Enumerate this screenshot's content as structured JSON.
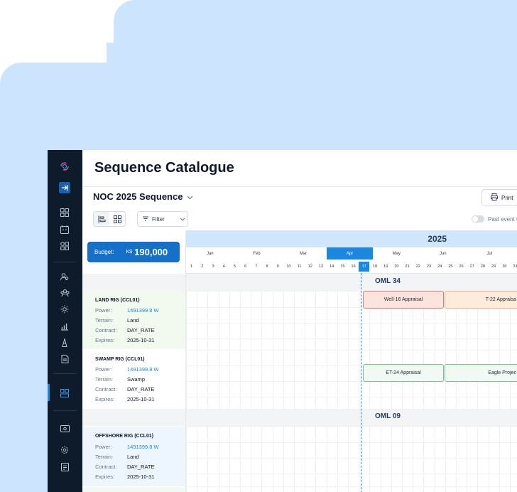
{
  "page": {
    "title": "Sequence Catalogue"
  },
  "header": {
    "sequence_name": "NOC 2025 Sequence",
    "print_label": "Print",
    "filter_label": "Filter",
    "past_events_label": "Past event t"
  },
  "budget": {
    "label": "Budget:",
    "currency": "K$",
    "amount": "190,000"
  },
  "timeline": {
    "year": "2025",
    "months": [
      "Jan",
      "Feb",
      "Mar",
      "Apr",
      "May",
      "Jun",
      "Jul"
    ],
    "active_month": "Apr",
    "days": [
      "1",
      "2",
      "3",
      "4",
      "5",
      "6",
      "7",
      "8",
      "9",
      "10",
      "11",
      "12",
      "13",
      "14",
      "15",
      "16",
      "17",
      "18",
      "19",
      "20",
      "21",
      "22",
      "23",
      "24",
      "25",
      "26",
      "27",
      "28",
      "29",
      "30",
      "31"
    ],
    "today": "17"
  },
  "groups": [
    {
      "label": "OML 34"
    },
    {
      "label": "OML 09"
    }
  ],
  "rigs": [
    {
      "name": "LAND RIG (CCL01)",
      "power_label": "Power:",
      "power": "1491399.8 W",
      "terrain_label": "Terrain:",
      "terrain": "Land",
      "contract_label": "Contract:",
      "contract": "DAY_RATE",
      "expires_label": "Expires:",
      "expires": "2025-10-31"
    },
    {
      "name": "SWAMP RIG (CCL01)",
      "power_label": "Power:",
      "power": "1491399.8 W",
      "terrain_label": "Terrain:",
      "terrain": "Swamp",
      "contract_label": "Contract:",
      "contract": "DAY_RATE",
      "expires_label": "Expires:",
      "expires": "2025-10-31"
    },
    {
      "name": "OFFSHORE RIG (CCL01)",
      "power_label": "Power:",
      "power": "1491399.8 W",
      "terrain_label": "Terrain:",
      "terrain": "Land",
      "contract_label": "Contract:",
      "contract": "DAY_RATE",
      "expires_label": "Expires:",
      "expires": "2025-10-31"
    }
  ],
  "events": [
    {
      "label": "Well-16 Appraisal"
    },
    {
      "label": "T-22 Appraisa"
    },
    {
      "label": "ET-24 Appraisal"
    },
    {
      "label": "Eagle Projec"
    }
  ],
  "colors": {
    "accent": "#1a87e0",
    "sidebar": "#0d1b2a",
    "background": "#cce5fc",
    "budget": "#1570c9"
  }
}
